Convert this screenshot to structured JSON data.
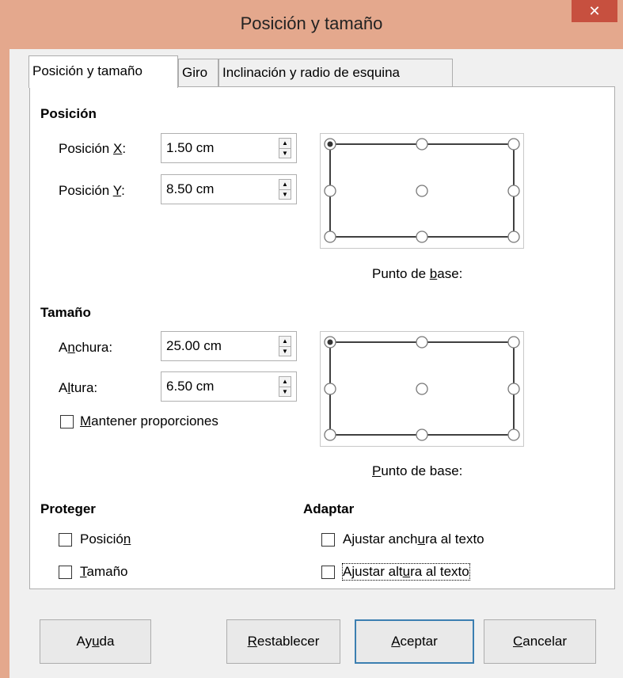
{
  "window": {
    "title": "Posición y tamaño",
    "close_glyph": "✕"
  },
  "tabs": [
    {
      "label": "Posición y tamaño",
      "active": true
    },
    {
      "label": "Giro",
      "active": false
    },
    {
      "label": "Inclinación y radio de esquina",
      "active": false
    }
  ],
  "position": {
    "title": "Posición",
    "x_label_pre": "Posición ",
    "x_label_u": "X",
    "x_label_post": ":",
    "x_value": "1.50 cm",
    "y_label_pre": "Posición ",
    "y_label_u": "Y",
    "y_label_post": ":",
    "y_value": "8.50 cm",
    "base_pre": "Punto de ",
    "base_u": "b",
    "base_post": "ase:"
  },
  "size": {
    "title": "Tamaño",
    "width_pre": "A",
    "width_u": "n",
    "width_post": "chura:",
    "width_value": "25.00 cm",
    "height_pre": "A",
    "height_u": "l",
    "height_post": "tura:",
    "height_value": "6.50 cm",
    "keep_u": "M",
    "keep_post": "antener proporciones",
    "keep_checked": false,
    "base_u": "P",
    "base_post": "unto de base:"
  },
  "protect": {
    "title": "Proteger",
    "pos_pre": "Posició",
    "pos_u": "n",
    "pos_post": "",
    "size_u": "T",
    "size_post": "amaño"
  },
  "adapt": {
    "title": "Adaptar",
    "fit_width_pre": "Ajustar anch",
    "fit_width_u": "u",
    "fit_width_post": "ra al texto",
    "fit_height_pre": "Ajustar alt",
    "fit_height_u": "u",
    "fit_height_post": "ra al texto"
  },
  "buttons": {
    "help_pre": "Ay",
    "help_u": "u",
    "help_post": "da",
    "reset_u": "R",
    "reset_post": "establecer",
    "ok_u": "A",
    "ok_post": "ceptar",
    "cancel_u": "C",
    "cancel_post": "ancelar"
  },
  "icons": {
    "spin_up": "▲",
    "spin_down": "▼"
  },
  "colors": {
    "titlebar": "#e4a88d",
    "close": "#c7503f",
    "default_button_border": "#3c7fb1"
  }
}
